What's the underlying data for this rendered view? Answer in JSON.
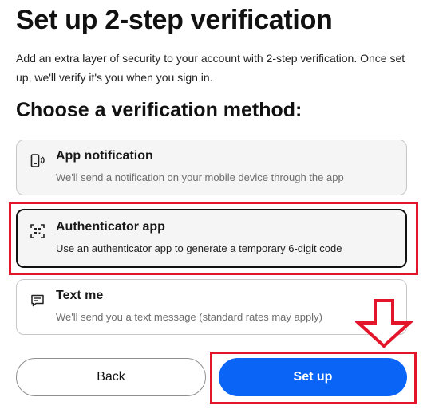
{
  "header": {
    "title": "Set up 2-step verification",
    "subtitle": "Add an extra layer of security to your account with 2-step verification. Once set up, we'll verify it's you when you sign in."
  },
  "section": {
    "heading": "Choose a verification method:"
  },
  "options": [
    {
      "icon": "phone-notification-icon",
      "title": "App notification",
      "description": "We'll send a notification on your mobile device through the app"
    },
    {
      "icon": "qr-scan-icon",
      "title": "Authenticator app",
      "description": "Use an authenticator app to generate a temporary 6-digit code",
      "selected": true
    },
    {
      "icon": "message-icon",
      "title": "Text me",
      "description": "We'll send you a text message (standard rates may apply)"
    }
  ],
  "buttons": {
    "back_label": "Back",
    "setup_label": "Set up"
  },
  "colors": {
    "primary": "#0a64f5",
    "annotation": "#e3152b",
    "selected_border": "#111111"
  }
}
